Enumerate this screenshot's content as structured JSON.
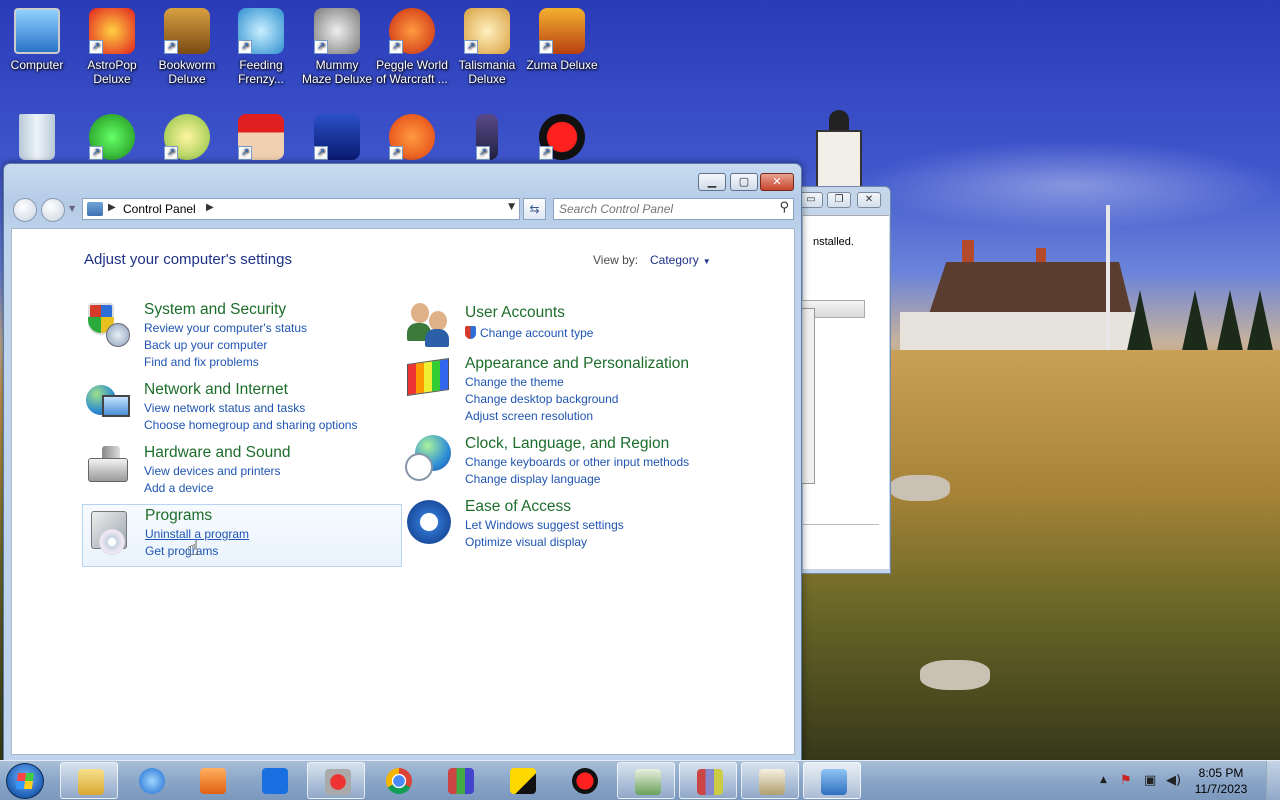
{
  "desktop": {
    "icons_row1": [
      {
        "label": "Computer",
        "icon": "computer-icon"
      },
      {
        "label": "AstroPop Deluxe",
        "icon": "astropop-icon"
      },
      {
        "label": "Bookworm Deluxe",
        "icon": "bookworm-icon"
      },
      {
        "label": "Feeding Frenzy...",
        "icon": "feeding-frenzy-icon"
      },
      {
        "label": "Mummy Maze Deluxe",
        "icon": "mummy-maze-icon"
      },
      {
        "label": "Peggle World of Warcraft ...",
        "icon": "peggle-wow-icon"
      },
      {
        "label": "Talismania Deluxe",
        "icon": "talismania-icon"
      },
      {
        "label": "Zuma Deluxe",
        "icon": "zuma-icon"
      }
    ],
    "icons_row2": [
      {
        "label": "",
        "icon": "recycle-bin-icon"
      },
      {
        "label": "",
        "icon": "radiation-app-icon"
      },
      {
        "label": "",
        "icon": "frog-app-icon"
      },
      {
        "label": "",
        "icon": "gnome-app-icon"
      },
      {
        "label": "",
        "icon": "mpi-app-icon"
      },
      {
        "label": "",
        "icon": "peggle-app-icon"
      },
      {
        "label": "",
        "icon": "tower-app-icon"
      },
      {
        "label": "",
        "icon": "record-app-icon"
      }
    ]
  },
  "back_window": {
    "text": "nstalled."
  },
  "window": {
    "address": {
      "breadcrumb": "Control Panel"
    },
    "search": {
      "placeholder": "Search Control Panel"
    },
    "heading": "Adjust your computer's settings",
    "view_by_label": "View by:",
    "view_by_value": "Category",
    "left_categories": [
      {
        "title": "System and Security",
        "links": [
          "Review your computer's status",
          "Back up your computer",
          "Find and fix problems"
        ]
      },
      {
        "title": "Network and Internet",
        "links": [
          "View network status and tasks",
          "Choose homegroup and sharing options"
        ]
      },
      {
        "title": "Hardware and Sound",
        "links": [
          "View devices and printers",
          "Add a device"
        ]
      },
      {
        "title": "Programs",
        "links": [
          "Uninstall a program",
          "Get programs"
        ]
      }
    ],
    "right_categories": [
      {
        "title": "User Accounts",
        "links": [
          "Change account type"
        ]
      },
      {
        "title": "Appearance and Personalization",
        "links": [
          "Change the theme",
          "Change desktop background",
          "Adjust screen resolution"
        ]
      },
      {
        "title": "Clock, Language, and Region",
        "links": [
          "Change keyboards or other input methods",
          "Change display language"
        ]
      },
      {
        "title": "Ease of Access",
        "links": [
          "Let Windows suggest settings",
          "Optimize visual display"
        ]
      }
    ]
  },
  "taskbar": {
    "items": [
      "file-explorer-icon",
      "internet-explorer-icon",
      "media-player-icon",
      "dropbox-icon",
      "installer-icon",
      "chrome-icon",
      "winrar-icon",
      "sticky-app-icon",
      "record-icon",
      "download-app-icon",
      "package-icon",
      "scanner-icon",
      "control-panel-icon"
    ],
    "tray": {
      "time": "8:05 PM",
      "date": "11/7/2023"
    }
  },
  "colors": {
    "category_title": "#1d6d2b",
    "link": "#1f55b2",
    "heading": "#1e3287"
  }
}
